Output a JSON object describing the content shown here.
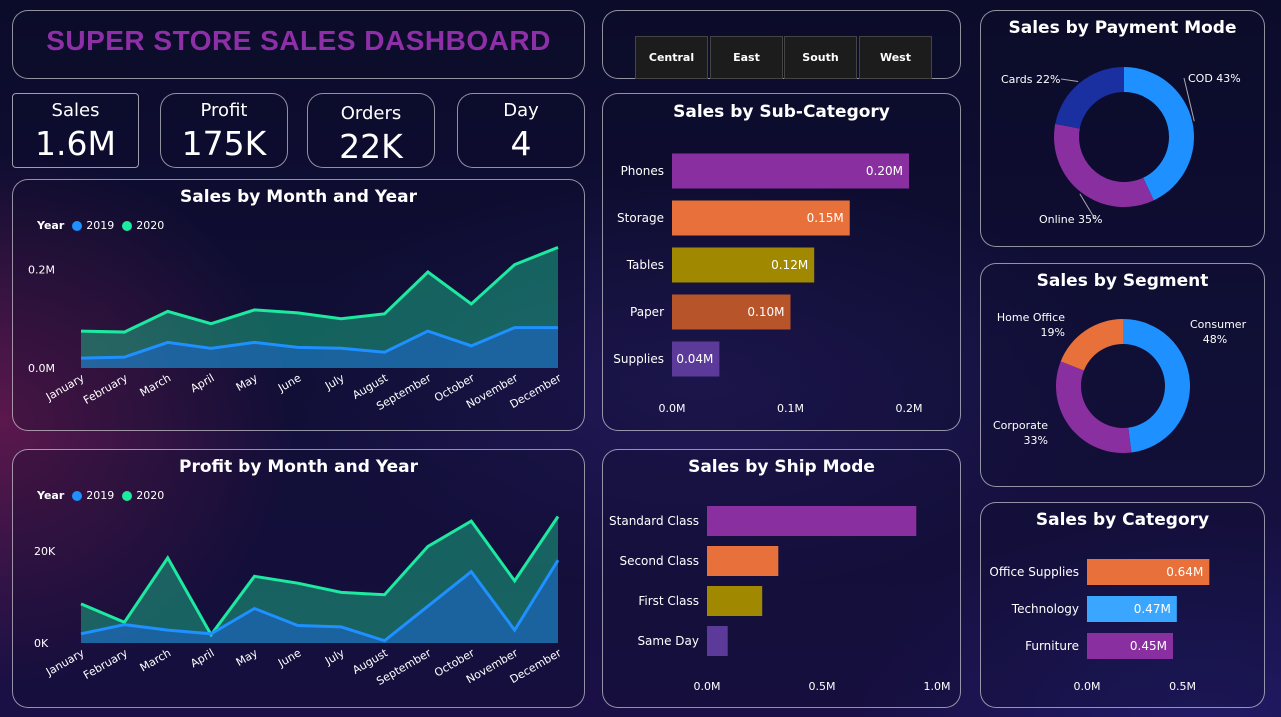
{
  "title": "SUPER STORE SALES DASHBOARD",
  "slicer": [
    "Central",
    "East",
    "South",
    "West"
  ],
  "kpis": {
    "sales": {
      "label": "Sales",
      "value": "1.6M"
    },
    "profit": {
      "label": "Profit",
      "value": "175K"
    },
    "orders": {
      "label": "Orders",
      "value": "22K"
    },
    "day": {
      "label": "Day",
      "value": "4"
    }
  },
  "legend": {
    "title": "Year",
    "s2019": "2019",
    "s2020": "2020"
  },
  "colors": {
    "y2019": "#1e90ff",
    "y2020": "#1de9a0",
    "purple": "#8a2f9f",
    "orange": "#e8703a",
    "olive": "#a08800",
    "rust": "#b8542a",
    "violet": "#5c3a9a",
    "lightblue": "#3ba6ff",
    "blue": "#1e90ff",
    "navy": "#1a2fa0"
  },
  "chart_data": [
    {
      "id": "sales_month",
      "type": "area",
      "title": "Sales by Month and Year",
      "categories": [
        "January",
        "February",
        "March",
        "April",
        "May",
        "June",
        "July",
        "August",
        "September",
        "October",
        "November",
        "December"
      ],
      "ylim": [
        0,
        0.26
      ],
      "yticks": [
        {
          "v": 0,
          "label": "0.0M"
        },
        {
          "v": 0.2,
          "label": "0.2M"
        }
      ],
      "series": [
        {
          "name": "2020",
          "values": [
            0.075,
            0.073,
            0.115,
            0.09,
            0.118,
            0.112,
            0.1,
            0.11,
            0.195,
            0.13,
            0.21,
            0.245
          ]
        },
        {
          "name": "2019",
          "values": [
            0.02,
            0.022,
            0.052,
            0.04,
            0.052,
            0.042,
            0.04,
            0.032,
            0.075,
            0.045,
            0.082,
            0.082
          ]
        }
      ]
    },
    {
      "id": "profit_month",
      "type": "area",
      "title": "Profit by Month and Year",
      "categories": [
        "January",
        "February",
        "March",
        "April",
        "May",
        "June",
        "July",
        "August",
        "September",
        "October",
        "November",
        "December"
      ],
      "ylim": [
        0,
        30000
      ],
      "yticks": [
        {
          "v": 0,
          "label": "0K"
        },
        {
          "v": 20000,
          "label": "20K"
        }
      ],
      "series": [
        {
          "name": "2020",
          "values": [
            8500,
            4500,
            18500,
            1800,
            14500,
            13000,
            11000,
            10500,
            21000,
            26500,
            13500,
            27500
          ]
        },
        {
          "name": "2019",
          "values": [
            2000,
            4000,
            2800,
            2000,
            7500,
            3800,
            3500,
            500,
            8000,
            15500,
            2800,
            18000
          ]
        }
      ]
    },
    {
      "id": "sales_subcat",
      "type": "bar",
      "title": "Sales by Sub-Category",
      "categories": [
        "Phones",
        "Storage",
        "Tables",
        "Paper",
        "Supplies"
      ],
      "values": [
        0.2,
        0.15,
        0.12,
        0.1,
        0.04
      ],
      "labels": [
        "0.20M",
        "0.15M",
        "0.12M",
        "0.10M",
        "0.04M"
      ],
      "xlim": [
        0,
        0.2
      ],
      "xticks": [
        {
          "v": 0,
          "label": "0.0M"
        },
        {
          "v": 0.1,
          "label": "0.1M"
        },
        {
          "v": 0.2,
          "label": "0.2M"
        }
      ],
      "colors": [
        "purple",
        "orange",
        "olive",
        "rust",
        "violet"
      ]
    },
    {
      "id": "sales_shipmode",
      "type": "bar",
      "title": "Sales by Ship Mode",
      "categories": [
        "Standard Class",
        "Second Class",
        "First Class",
        "Same Day"
      ],
      "values": [
        0.91,
        0.31,
        0.24,
        0.09
      ],
      "xlim": [
        0,
        1.0
      ],
      "xticks": [
        {
          "v": 0,
          "label": "0.0M"
        },
        {
          "v": 0.5,
          "label": "0.5M"
        },
        {
          "v": 1.0,
          "label": "1.0M"
        }
      ],
      "colors": [
        "purple",
        "orange",
        "olive",
        "violet"
      ]
    },
    {
      "id": "sales_payment",
      "type": "pie",
      "title": "Sales by Payment Mode",
      "slices": [
        {
          "label": "COD 43%",
          "value": 43,
          "color": "blue"
        },
        {
          "label": "Online 35%",
          "value": 35,
          "color": "purple"
        },
        {
          "label": "Cards 22%",
          "value": 22,
          "color": "navy"
        }
      ]
    },
    {
      "id": "sales_segment",
      "type": "pie",
      "title": "Sales by Segment",
      "slices": [
        {
          "label": "Consumer",
          "pct": "48%",
          "value": 48,
          "color": "blue"
        },
        {
          "label": "Corporate",
          "pct": "33%",
          "value": 33,
          "color": "purple"
        },
        {
          "label": "Home Office",
          "pct": "19%",
          "value": 19,
          "color": "orange"
        }
      ]
    },
    {
      "id": "sales_category",
      "type": "bar",
      "title": "Sales by Category",
      "categories": [
        "Office Supplies",
        "Technology",
        "Furniture"
      ],
      "values": [
        0.64,
        0.47,
        0.45
      ],
      "labels": [
        "0.64M",
        "0.47M",
        "0.45M"
      ],
      "xlim": [
        0,
        0.9
      ],
      "xticks": [
        {
          "v": 0,
          "label": "0.0M"
        },
        {
          "v": 0.5,
          "label": "0.5M"
        }
      ],
      "colors": [
        "orange",
        "lightblue",
        "purple"
      ]
    }
  ]
}
